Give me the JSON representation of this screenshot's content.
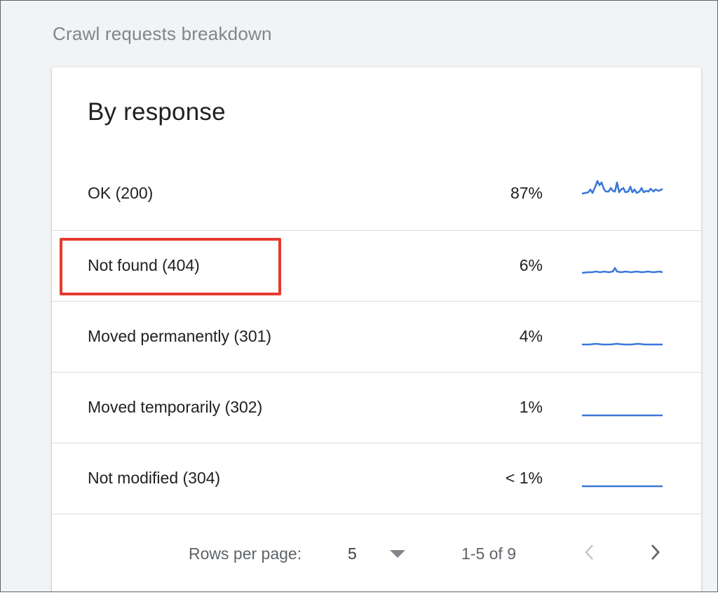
{
  "section": {
    "title": "Crawl requests breakdown"
  },
  "card": {
    "title": "By response"
  },
  "rows": [
    {
      "label": "OK (200)",
      "percent": "87%"
    },
    {
      "label": "Not found (404)",
      "percent": "6%"
    },
    {
      "label": "Moved permanently (301)",
      "percent": "4%"
    },
    {
      "label": "Moved temporarily (302)",
      "percent": "1%"
    },
    {
      "label": "Not modified (304)",
      "percent": "< 1%"
    }
  ],
  "pagination": {
    "rows_per_page_label": "Rows per page:",
    "rows_per_page_value": "5",
    "range_text": "1-5 of 9",
    "prev_icon": "chevron-left-icon",
    "next_icon": "chevron-right-icon"
  },
  "colors": {
    "sparkline": "#3c78d8",
    "highlight": "#e53a2f"
  }
}
